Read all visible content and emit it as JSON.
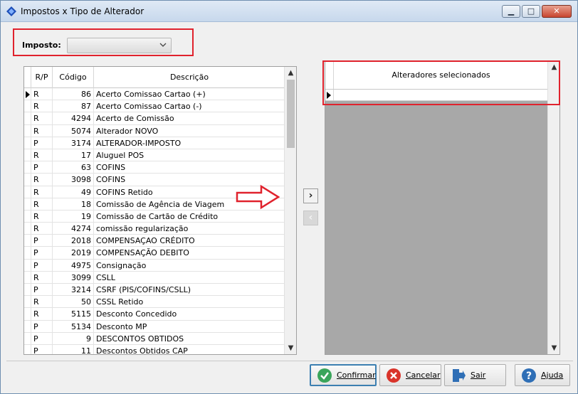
{
  "window": {
    "title": "Impostos x Tipo de Alterador"
  },
  "imposto": {
    "label": "Imposto:",
    "value": ""
  },
  "left_grid": {
    "columns": [
      "R/P",
      "Código",
      "Descrição"
    ],
    "rows": [
      {
        "rp": "R",
        "codigo": "86",
        "descricao": "Acerto Comissao Cartao (+)"
      },
      {
        "rp": "R",
        "codigo": "87",
        "descricao": "Acerto Comissao Cartao (-)"
      },
      {
        "rp": "R",
        "codigo": "4294",
        "descricao": "Acerto de Comissão"
      },
      {
        "rp": "R",
        "codigo": "5074",
        "descricao": "Alterador NOVO"
      },
      {
        "rp": "P",
        "codigo": "3174",
        "descricao": "ALTERADOR-IMPOSTO"
      },
      {
        "rp": "R",
        "codigo": "17",
        "descricao": "Aluguel POS"
      },
      {
        "rp": "P",
        "codigo": "63",
        "descricao": "COFINS"
      },
      {
        "rp": "R",
        "codigo": "3098",
        "descricao": "COFINS"
      },
      {
        "rp": "R",
        "codigo": "49",
        "descricao": "COFINS Retido"
      },
      {
        "rp": "R",
        "codigo": "18",
        "descricao": "Comissão de Agência de Viagem"
      },
      {
        "rp": "R",
        "codigo": "19",
        "descricao": "Comissão de Cartão de Crédito"
      },
      {
        "rp": "R",
        "codigo": "4274",
        "descricao": "comissão regularização"
      },
      {
        "rp": "P",
        "codigo": "2018",
        "descricao": "COMPENSAÇAO CRÉDITO"
      },
      {
        "rp": "P",
        "codigo": "2019",
        "descricao": "COMPENSAÇÃO DEBITO"
      },
      {
        "rp": "P",
        "codigo": "4975",
        "descricao": "Consignação"
      },
      {
        "rp": "R",
        "codigo": "3099",
        "descricao": "CSLL"
      },
      {
        "rp": "P",
        "codigo": "3214",
        "descricao": "CSRF (PIS/COFINS/CSLL)"
      },
      {
        "rp": "R",
        "codigo": "50",
        "descricao": "CSSL Retido"
      },
      {
        "rp": "R",
        "codigo": "5115",
        "descricao": "Desconto Concedido"
      },
      {
        "rp": "P",
        "codigo": "5134",
        "descricao": "Desconto MP"
      },
      {
        "rp": "P",
        "codigo": "9",
        "descricao": "DESCONTOS OBTIDOS"
      },
      {
        "rp": "P",
        "codigo": "11",
        "descricao": "Descontos Obtidos CAP"
      }
    ]
  },
  "right_grid": {
    "header": "Alteradores selecionados"
  },
  "move_buttons": {
    "add": "›",
    "remove": "‹"
  },
  "buttons": {
    "confirmar": "Confirmar",
    "cancelar": "Cancelar",
    "sair": "Sair",
    "ajuda": "Ajuda"
  },
  "colors": {
    "highlight_red": "#e0222d",
    "accent_blue": "#3c7fb1"
  }
}
